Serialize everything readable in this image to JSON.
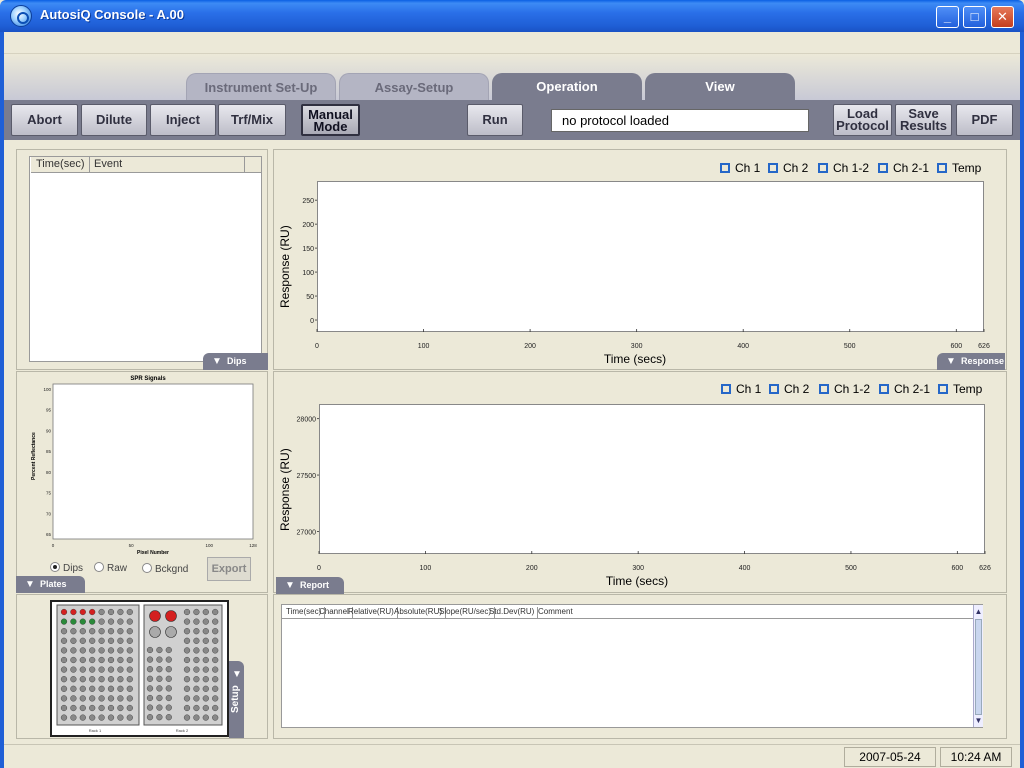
{
  "window": {
    "title": "AutosiQ Console - A.00",
    "min": "_",
    "max": "□",
    "close": "✕"
  },
  "tabs": [
    {
      "label": "Instrument Set-Up"
    },
    {
      "label": "Assay-Setup"
    },
    {
      "label": "Operation"
    },
    {
      "label": "View"
    }
  ],
  "toolbar": {
    "abort": "Abort",
    "dilute": "Dilute",
    "inject": "Inject",
    "trf": "Trf/Mix",
    "manual_1": "Manual",
    "manual_2": "Mode",
    "run": "Run",
    "protocol_status": "no protocol loaded",
    "load_1": "Load",
    "load_2": "Protocol",
    "save_1": "Save",
    "save_2": "Results",
    "pdf": "PDF"
  },
  "event_table": {
    "col_time": "Time(sec)",
    "col_event": "Event"
  },
  "flags": {
    "dips": "Dips",
    "plates": "Plates",
    "response": "Response",
    "report": "Report Tbl",
    "setup": "Setup"
  },
  "spr": {
    "title": "SPR Signals",
    "ylabel": "Percent Reflectance",
    "xlabel": "Pixel Number",
    "yticks": [
      "100",
      "95",
      "90",
      "85",
      "80",
      "75",
      "70",
      "65"
    ],
    "xticks": [
      "0",
      "50",
      "100",
      "128"
    ]
  },
  "radios": {
    "dips": "Dips",
    "raw": "Raw",
    "bckgnd": "Bckgnd",
    "export": "Export"
  },
  "chart1": {
    "legend": [
      "Ch 1",
      "Ch 2",
      "Ch 1-2",
      "Ch 2-1",
      "Temp"
    ],
    "ylabel": "Response (RU)",
    "xlabel": "Time (secs)",
    "yticks": [
      "250",
      "200",
      "150",
      "100",
      "50",
      "0"
    ],
    "xticks": [
      "0",
      "100",
      "200",
      "300",
      "400",
      "500",
      "600",
      "626"
    ]
  },
  "chart2": {
    "legend": [
      "Ch 1",
      "Ch 2",
      "Ch 1-2",
      "Ch 2-1",
      "Temp"
    ],
    "ylabel": "Response (RU)",
    "xlabel": "Time (secs)",
    "yticks": [
      "28000",
      "27500",
      "27000"
    ],
    "xticks": [
      "0",
      "100",
      "200",
      "300",
      "400",
      "500",
      "600",
      "626"
    ]
  },
  "report_table": {
    "columns": [
      "Time(sec)",
      "Channel",
      "Relative(RU)",
      "Absolute(RU)",
      "Slope(RU/sec)",
      "Std.Dev(RU)",
      "Comment"
    ]
  },
  "plates": {
    "rack1": "Rack 1",
    "rack2": "Rack 2"
  },
  "status": {
    "date": "2007-05-24",
    "time": "10:24 AM"
  }
}
